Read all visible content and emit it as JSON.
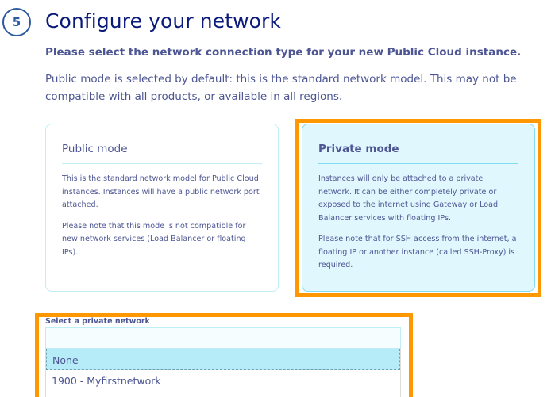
{
  "step": {
    "number": "5",
    "title": "Configure your network"
  },
  "instruction": "Please select the network connection type for your new Public Cloud instance.",
  "description": "Public mode is selected by default: this is the standard network model. This may not be compatible with all products, or available in all regions.",
  "modes": {
    "public": {
      "title": "Public mode",
      "paragraph1": "This is the standard network model for Public Cloud instances. Instances will have a public network port attached.",
      "paragraph2": "Please note that this mode is not compatible for new network services (Load Balancer or floating IPs)."
    },
    "private": {
      "title": "Private mode",
      "paragraph1": "Instances will only be attached to a private network. It can be either completely private or exposed to the internet using Gateway or Load Balancer services with floating IPs.",
      "paragraph2": "Please note that for SSH access from the internet, a floating IP or another instance (called SSH-Proxy) is required."
    }
  },
  "private_network": {
    "label": "Select a private network",
    "selected_value": "",
    "options": [
      "None",
      "1900 - Myfirstnetwork"
    ]
  },
  "colors": {
    "accent": "#ff9800",
    "title": "#0a1a7a",
    "text": "#4d5693",
    "selected_card": "#e0f7fd",
    "selected_option": "#b5ecf8"
  }
}
